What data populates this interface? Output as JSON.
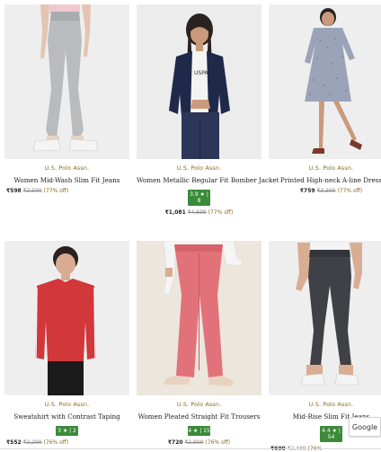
{
  "products": [
    {
      "brand": "U.S. Polo Assn.",
      "name": "Women Mid-Wash Slim Fit Jeans",
      "rating": "",
      "price": "₹598",
      "mrp": "₹2,599",
      "discount": "(77% off)"
    },
    {
      "brand": "U.S. Polo Assn.",
      "name": "Women Metallic Regular Fit Bomber Jacket",
      "rating": "3.9 ★ | 8",
      "price": "₹1,081",
      "mrp": "₹4,699",
      "discount": "(77% off)"
    },
    {
      "brand": "U.S. Polo Assn.",
      "name": "Printed High-neck A-line Dress",
      "rating": "",
      "price": "₹759",
      "mrp": "₹3,299",
      "discount": "(77% off)"
    },
    {
      "brand": "U.S. Polo Assn.",
      "name": "Sweatshirt with Contrast Taping",
      "rating": "3 ★ | 2",
      "price": "₹552",
      "mrp": "₹2,299",
      "discount": "(76% off)"
    },
    {
      "brand": "U.S. Polo Assn.",
      "name": "Women Pleated Straight Fit Trousers",
      "rating": "4 ★ | 15",
      "price": "₹720",
      "mrp": "₹2,999",
      "discount": "(76% off)"
    },
    {
      "brand": "U.S. Polo Assn.",
      "name": "Mid-Rise Slim Fit Jeans",
      "rating": "4.4 ★ | 54",
      "price": "₹600",
      "mrp": "₹2,499",
      "discount": "(76%"
    }
  ],
  "google_badge": "Google",
  "colors": {
    "brand": "#8a6a1e",
    "rating_bg": "#3a8a3a",
    "discount": "#8a6a1e"
  }
}
